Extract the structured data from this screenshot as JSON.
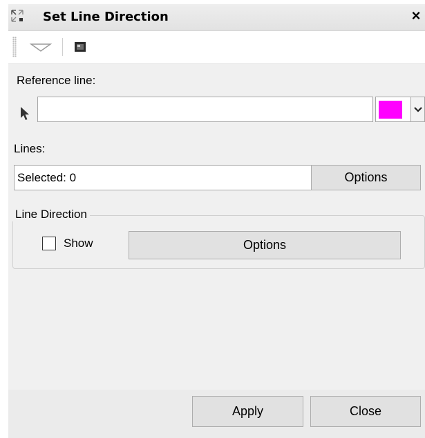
{
  "window": {
    "title": "Set Line Direction",
    "close_glyph": "×"
  },
  "toolbar": {
    "icons": [
      "expand-arrow-icon",
      "panel-icon"
    ]
  },
  "reference": {
    "label": "Reference line:",
    "value": "",
    "color": "#ff00ff"
  },
  "lines": {
    "label": "Lines:",
    "selected_text": "Selected: 0",
    "options_label": "Options"
  },
  "line_direction": {
    "group_label": "Line Direction",
    "show_label": "Show",
    "show_checked": false,
    "options_label": "Options"
  },
  "footer": {
    "apply_label": "Apply",
    "close_label": "Close"
  }
}
